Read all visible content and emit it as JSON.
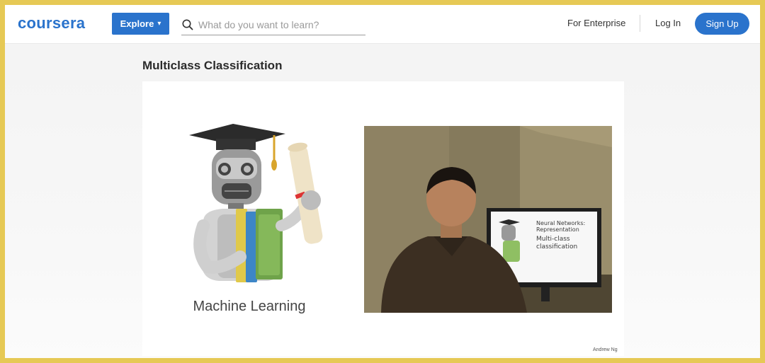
{
  "header": {
    "logo_text": "coursera",
    "explore_label": "Explore",
    "search_placeholder": "What do you want to learn?",
    "enterprise_label": "For Enterprise",
    "login_label": "Log In",
    "signup_label": "Sign Up"
  },
  "main": {
    "title": "Multiclass Classification",
    "slide": {
      "course_caption": "Machine Learning",
      "monitor_title": "Neural Networks: Representation",
      "monitor_subtitle": "Multi-class classification",
      "credit": "Andrew Ng"
    }
  },
  "colors": {
    "brand": "#2a73cc",
    "frame": "#e6c955"
  }
}
